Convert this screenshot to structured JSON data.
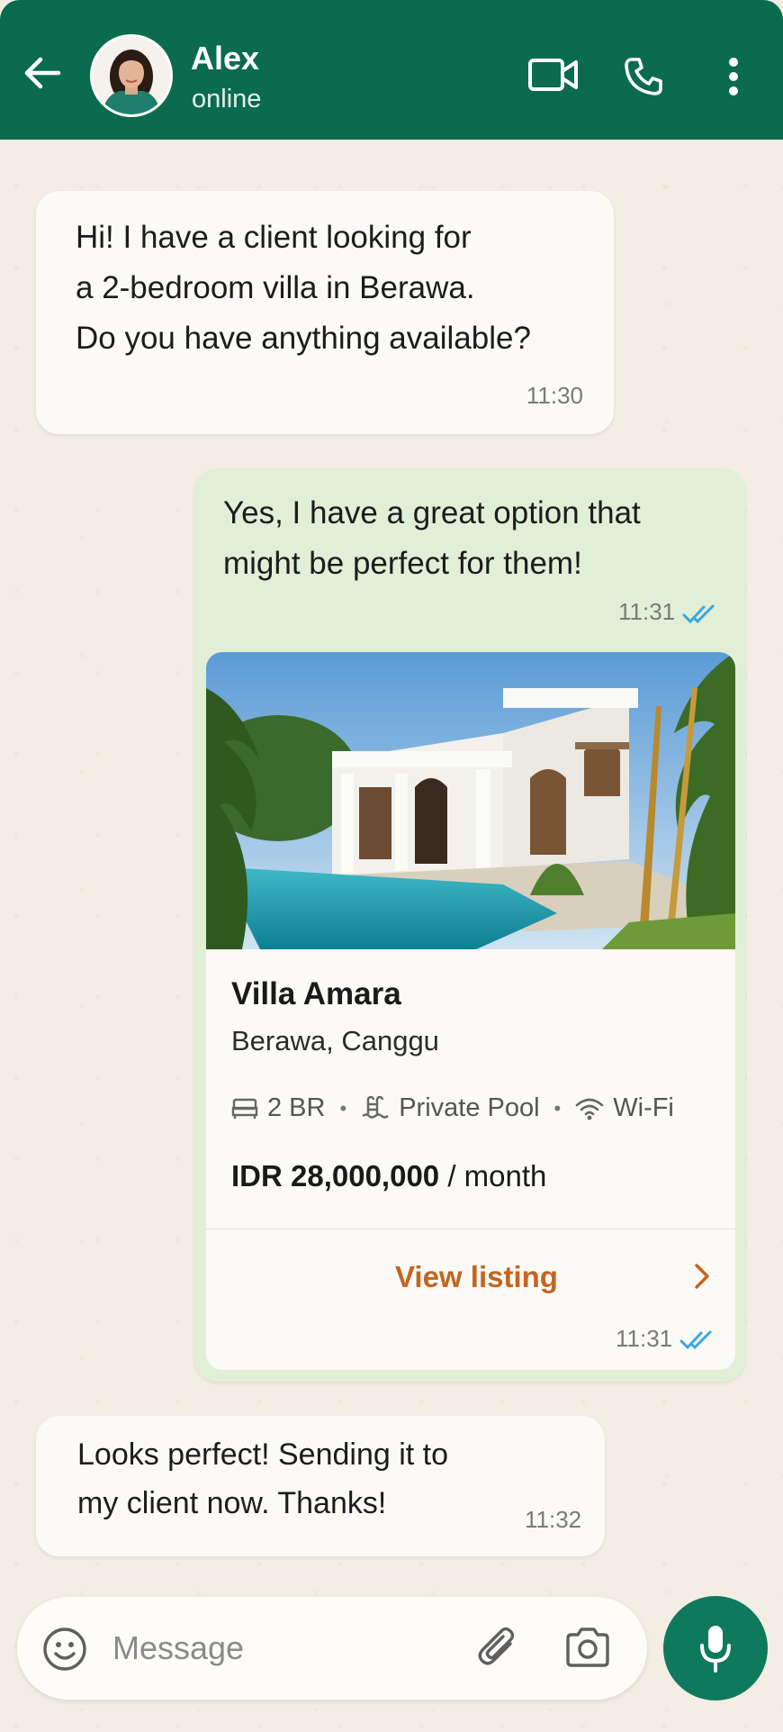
{
  "header": {
    "contact_name": "Alex",
    "status": "online",
    "icons": [
      "back-arrow-icon",
      "video-call-icon",
      "phone-icon",
      "more-vert-icon"
    ],
    "bg_color": "#0b6b4e"
  },
  "messages": [
    {
      "direction": "incoming",
      "lines": [
        "Hi! I have a client looking for",
        "a 2-bedroom villa in Berawa.",
        "Do you have anything available?"
      ],
      "time": "11:30"
    },
    {
      "direction": "outgoing",
      "lines": [
        "Yes, I have a great option that",
        "might be perfect for them!"
      ],
      "time": "11:31",
      "read": true
    },
    {
      "direction": "outgoing",
      "type": "listing-card",
      "card": {
        "name": "Villa Amara",
        "location": "Berawa, Canggu",
        "amenities": [
          "2 BR",
          "Private Pool",
          "Wi-Fi"
        ],
        "price": "IDR 28,000,000",
        "price_suffix": "/ month",
        "cta": "View listing"
      },
      "time": "11:31",
      "read": true
    },
    {
      "direction": "incoming",
      "lines": [
        "Looks perfect! Sending it to",
        "my client now. Thanks!"
      ],
      "time": "11:32"
    }
  ],
  "composer": {
    "placeholder": "Message",
    "icons": [
      "emoji-icon",
      "attach-icon",
      "camera-icon",
      "mic-icon"
    ]
  },
  "colors": {
    "accent_green": "#0f7a5b",
    "outgoing_bubble": "#e1efd7",
    "cta_orange": "#c5641e",
    "read_tick": "#3aa7e0"
  }
}
